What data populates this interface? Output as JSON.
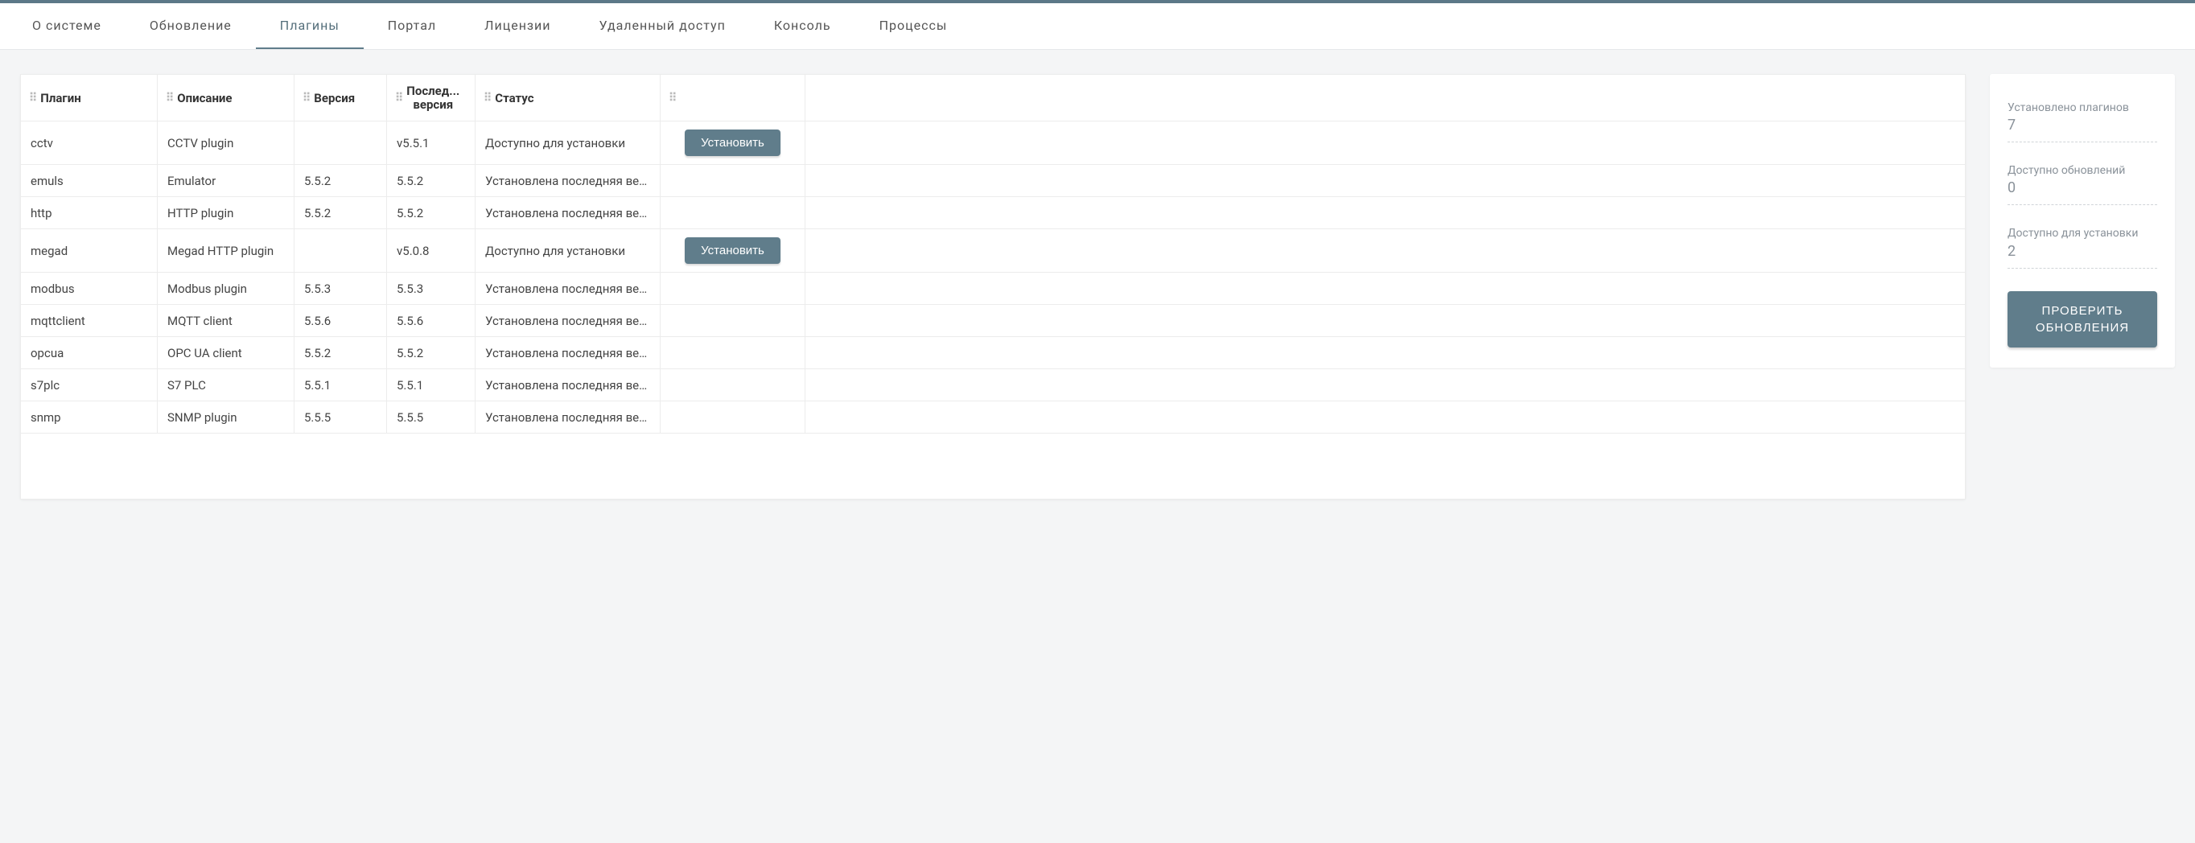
{
  "tabs": [
    {
      "label": "О системе",
      "active": false
    },
    {
      "label": "Обновление",
      "active": false
    },
    {
      "label": "Плагины",
      "active": true
    },
    {
      "label": "Портал",
      "active": false
    },
    {
      "label": "Лицензии",
      "active": false
    },
    {
      "label": "Удаленный доступ",
      "active": false
    },
    {
      "label": "Консоль",
      "active": false
    },
    {
      "label": "Процессы",
      "active": false
    }
  ],
  "table": {
    "headers": {
      "plugin": "Плагин",
      "description": "Описание",
      "version": "Версия",
      "latest_top": "Послед...",
      "latest_bottom": "версия",
      "status": "Статус"
    },
    "rows": [
      {
        "plugin": "cctv",
        "description": "CCTV plugin",
        "version": "",
        "latest": "v5.5.1",
        "status": "Доступно для установки",
        "action": "Установить"
      },
      {
        "plugin": "emuls",
        "description": "Emulator",
        "version": "5.5.2",
        "latest": "5.5.2",
        "status": "Установлена последняя вер...",
        "action": ""
      },
      {
        "plugin": "http",
        "description": "HTTP plugin",
        "version": "5.5.2",
        "latest": "5.5.2",
        "status": "Установлена последняя вер...",
        "action": ""
      },
      {
        "plugin": "megad",
        "description": "Megad HTTP plugin",
        "version": "",
        "latest": "v5.0.8",
        "status": "Доступно для установки",
        "action": "Установить"
      },
      {
        "plugin": "modbus",
        "description": "Modbus plugin",
        "version": "5.5.3",
        "latest": "5.5.3",
        "status": "Установлена последняя вер...",
        "action": ""
      },
      {
        "plugin": "mqttclient",
        "description": "MQTT client",
        "version": "5.5.6",
        "latest": "5.5.6",
        "status": "Установлена последняя вер...",
        "action": ""
      },
      {
        "plugin": "opcua",
        "description": "OPC UA client",
        "version": "5.5.2",
        "latest": "5.5.2",
        "status": "Установлена последняя вер...",
        "action": ""
      },
      {
        "plugin": "s7plc",
        "description": "S7 PLC",
        "version": "5.5.1",
        "latest": "5.5.1",
        "status": "Установлена последняя вер...",
        "action": ""
      },
      {
        "plugin": "snmp",
        "description": "SNMP plugin",
        "version": "5.5.5",
        "latest": "5.5.5",
        "status": "Установлена последняя вер...",
        "action": ""
      }
    ]
  },
  "sidebar": {
    "installed_label": "Установлено плагинов",
    "installed_value": "7",
    "updates_label": "Доступно обновлений",
    "updates_value": "0",
    "available_label": "Доступно для установки",
    "available_value": "2",
    "check_button": "ПРОВЕРИТЬ ОБНОВЛЕНИЯ"
  }
}
